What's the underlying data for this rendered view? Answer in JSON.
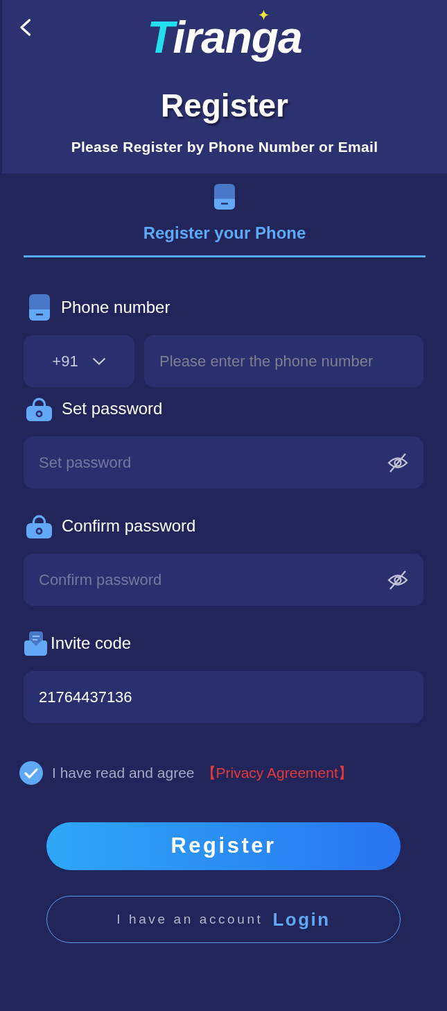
{
  "brand": {
    "logo": "Tiranga"
  },
  "title": "Register",
  "subtitle": "Please Register by Phone Number or Email",
  "tabs": [
    {
      "label": "Register your Phone",
      "selected": true
    }
  ],
  "fields": [
    {
      "kind": "phone",
      "label": "Phone number",
      "country_code": "+91",
      "placeholder": "Please enter the phone number"
    },
    {
      "kind": "password",
      "label": "Set password",
      "placeholder": "Set password"
    },
    {
      "kind": "password",
      "label": "Confirm password",
      "placeholder": "Confirm password"
    },
    {
      "kind": "invite",
      "label": "Invite code",
      "value": "21764437136"
    }
  ],
  "agreement": {
    "checked": true,
    "text": "I have read and agree",
    "link": "【Privacy Agreement】"
  },
  "buttons": {
    "register": "Register",
    "login_prompt": "I have an account",
    "login": "Login"
  }
}
